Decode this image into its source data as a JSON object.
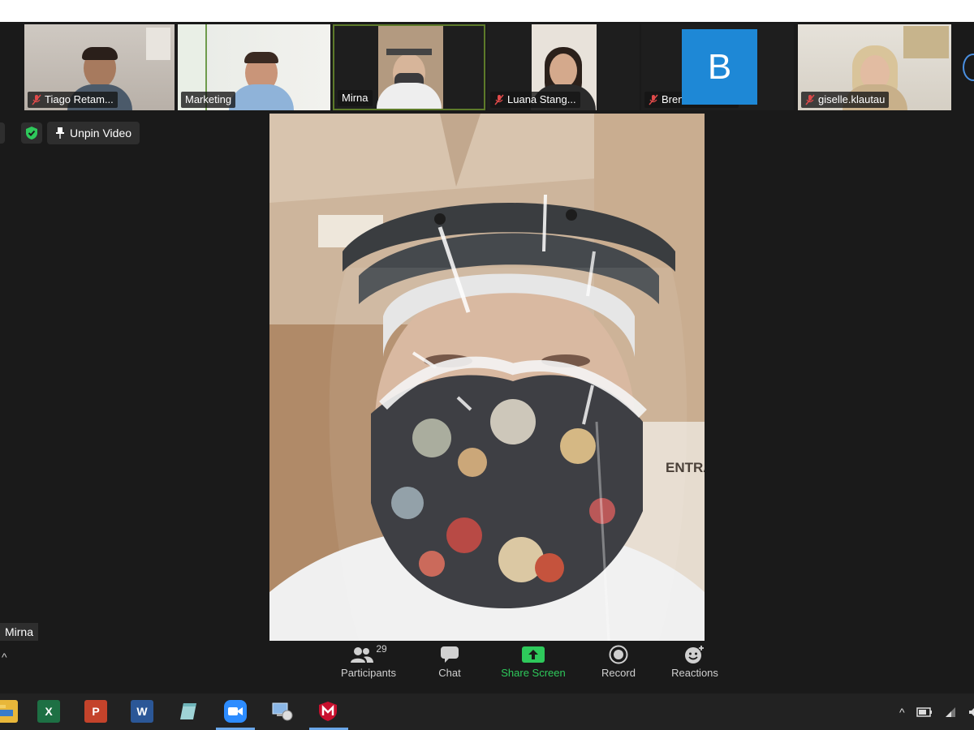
{
  "participants_strip": [
    {
      "name": "Tiago Retam...",
      "muted": true,
      "type": "video"
    },
    {
      "name": "Marketing",
      "muted": false,
      "type": "video"
    },
    {
      "name": "Mirna",
      "muted": false,
      "type": "video",
      "active": true
    },
    {
      "name": "Luana Stang...",
      "muted": true,
      "type": "video"
    },
    {
      "name": "Brenda Freita...",
      "muted": true,
      "type": "avatar",
      "avatar_letter": "B"
    },
    {
      "name": "giselle.klautau",
      "muted": true,
      "type": "video"
    }
  ],
  "toolbar_top": {
    "unpin_label": "Unpin Video"
  },
  "main_video": {
    "speaker_name": "Mirna",
    "wall_text": "ENTRA"
  },
  "controls": {
    "participants_label": "Participants",
    "participants_count": "29",
    "chat_label": "Chat",
    "share_label": "Share Screen",
    "record_label": "Record",
    "reactions_label": "Reactions"
  },
  "taskbar": {
    "apps": [
      "file-explorer-icon",
      "excel-icon",
      "powerpoint-icon",
      "word-icon",
      "notes-icon",
      "zoom-icon",
      "network-icon",
      "mcafee-icon"
    ]
  },
  "colors": {
    "share_green": "#2ec95b",
    "avatar_blue": "#1e88d6",
    "mute_red": "#e04a4a"
  }
}
